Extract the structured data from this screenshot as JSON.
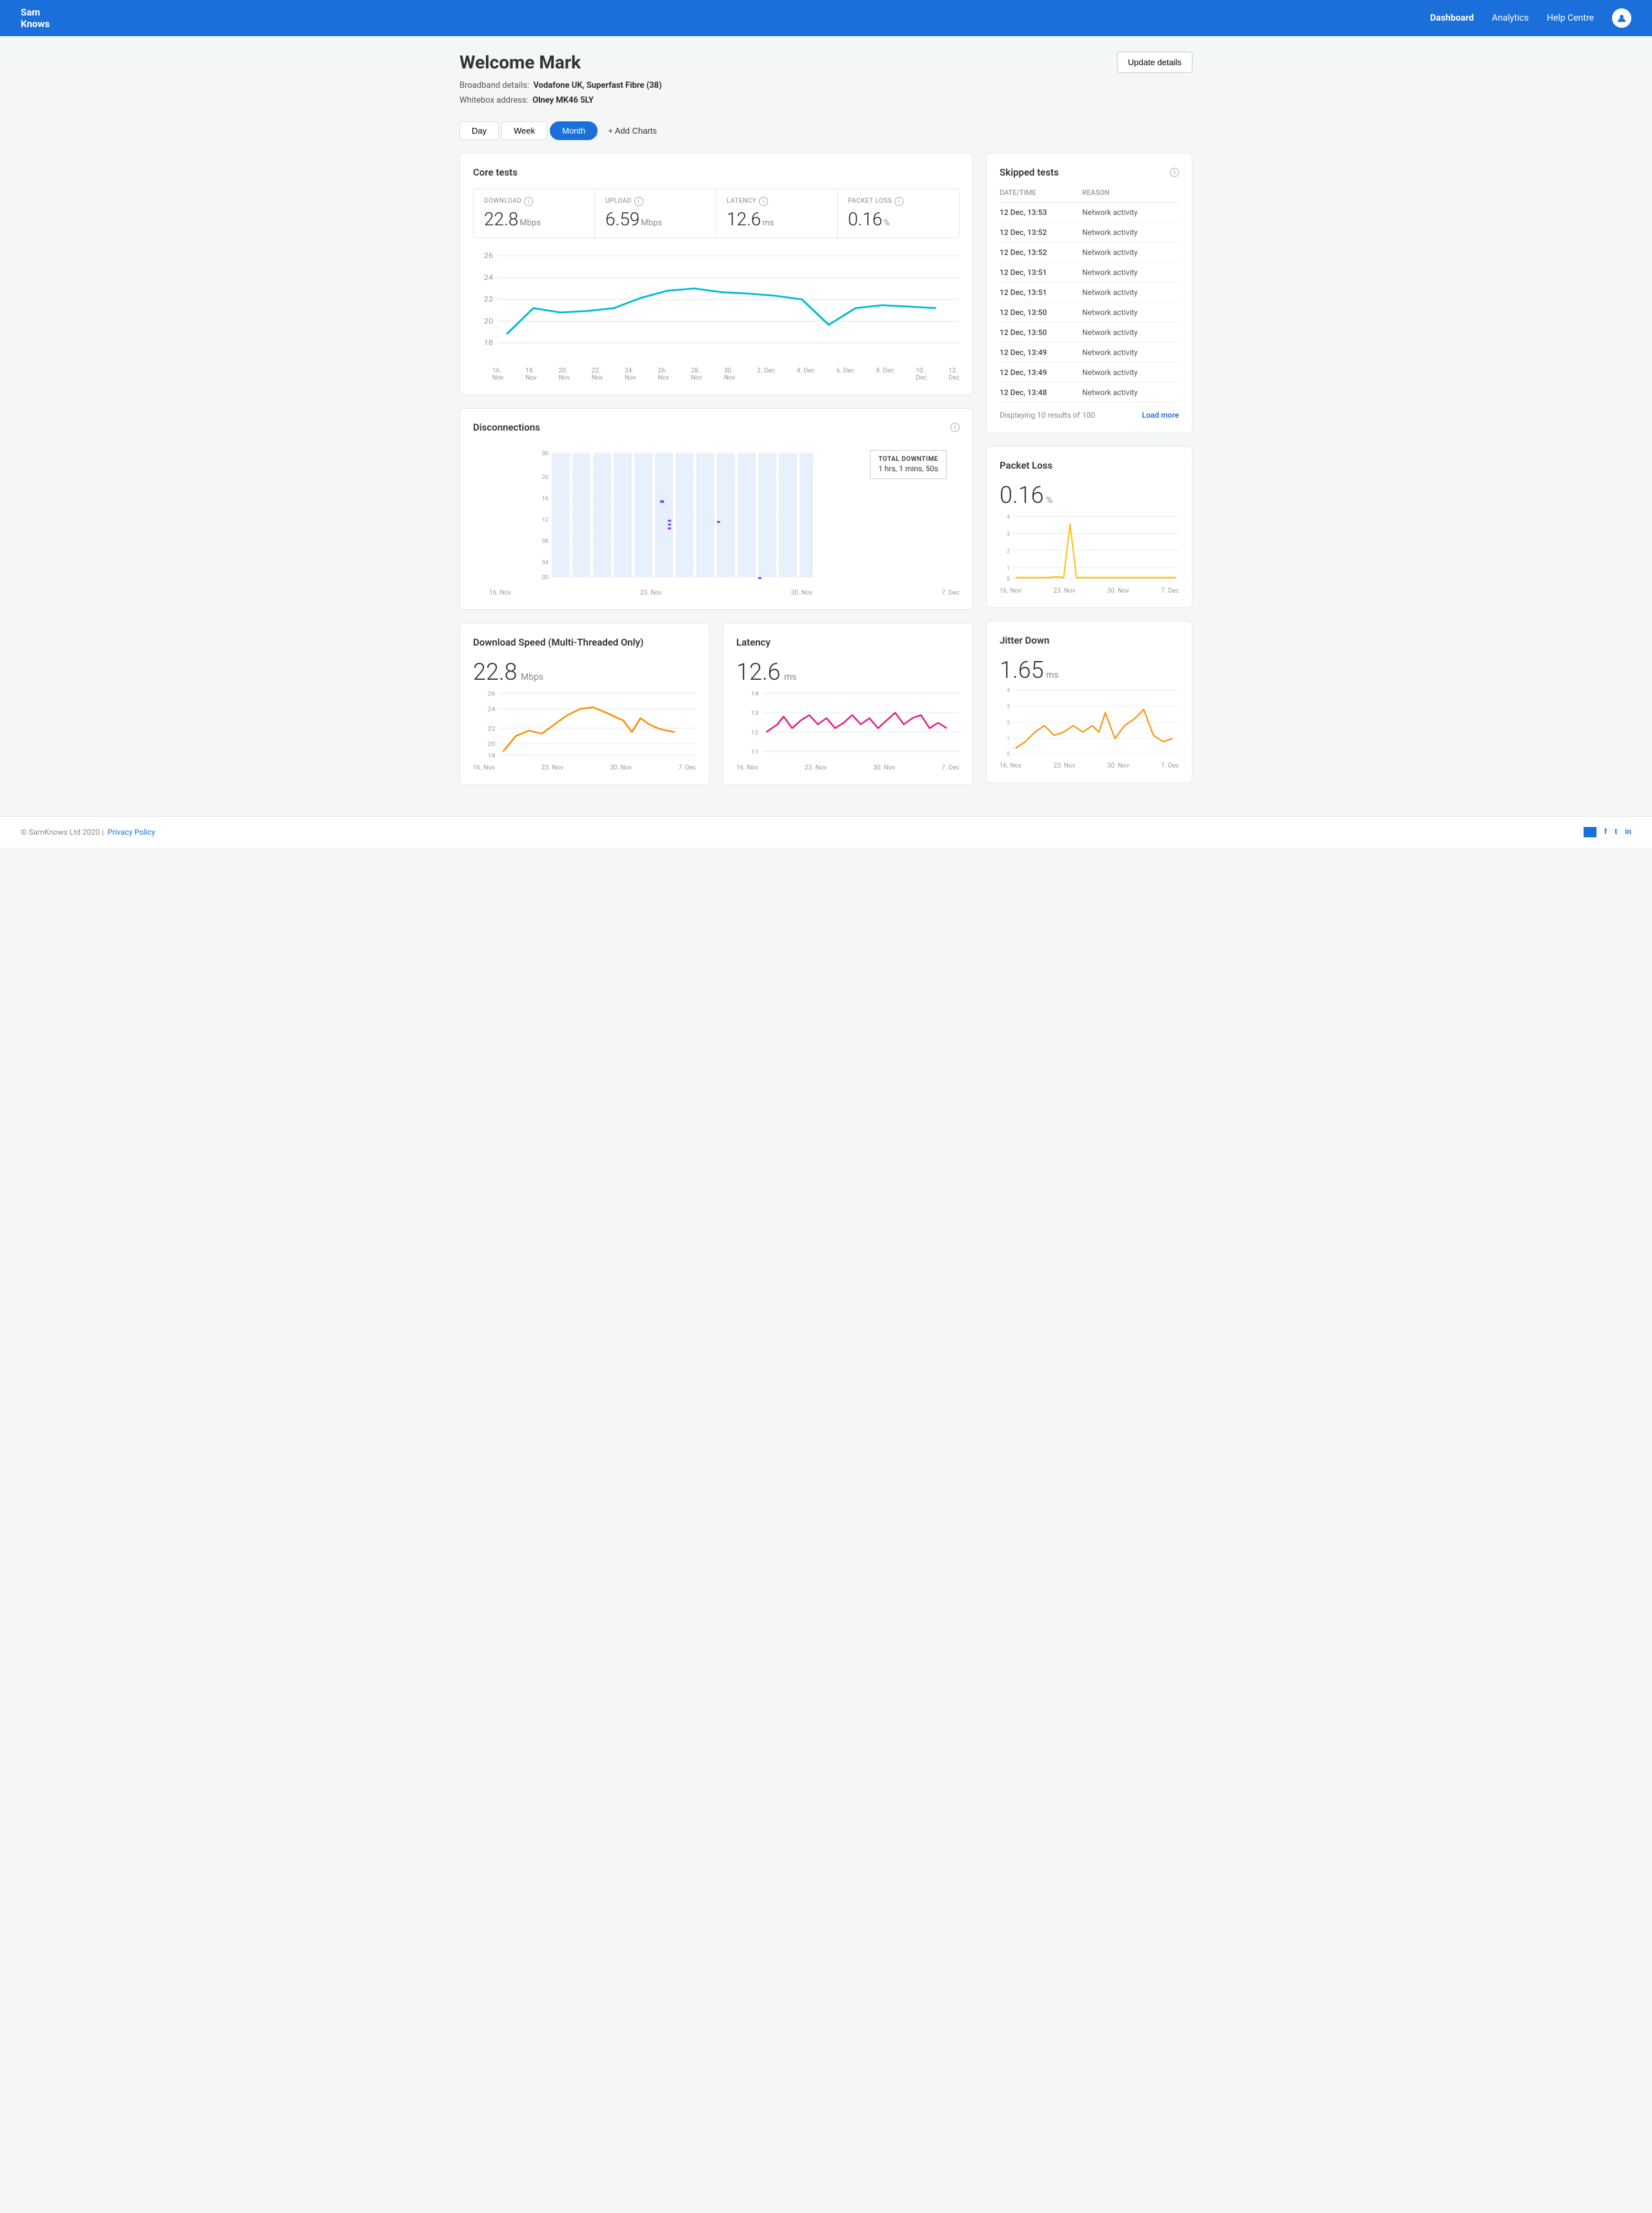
{
  "header": {
    "logo_line1": "Sam",
    "logo_line2": "Knows",
    "nav": [
      {
        "label": "Dashboard",
        "active": true
      },
      {
        "label": "Analytics",
        "active": false
      },
      {
        "label": "Help Centre",
        "active": false
      }
    ]
  },
  "page": {
    "welcome": "Welcome Mark",
    "broadband_label": "Broadband details:",
    "broadband_value": "Vodafone UK, Superfast Fibre (38)",
    "whitebox_label": "Whitebox address:",
    "whitebox_value": "Olney MK46 5LY",
    "update_btn": "Update details"
  },
  "time_tabs": {
    "tabs": [
      "Day",
      "Week",
      "Month"
    ],
    "active": "Month",
    "add_label": "+ Add Charts"
  },
  "core_tests": {
    "title": "Core tests",
    "metrics": [
      {
        "label": "DOWNLOAD",
        "value": "22.8",
        "unit": "Mbps"
      },
      {
        "label": "UPLOAD",
        "value": "6.59",
        "unit": "Mbps"
      },
      {
        "label": "LATENCY",
        "value": "12.6",
        "unit": "ms"
      },
      {
        "label": "PACKET LOSS",
        "value": "0.16",
        "unit": "%"
      }
    ],
    "chart_x_labels": [
      "16.\nNov",
      "18.\nNov",
      "20.\nNov",
      "22.\nNov",
      "24.\nNov",
      "26.\nNov",
      "28.\nNov",
      "30.\nNov",
      "2. Dec",
      "4. Dec",
      "6. Dec",
      "8. Dec",
      "10.\nDec",
      "12.\nDec"
    ]
  },
  "disconnections": {
    "title": "Disconnections",
    "total_downtime_label": "TOTAL DOWNTIME",
    "total_downtime_value": "1 hrs, 1 mins, 50s",
    "chart_x_labels": [
      "16. Nov",
      "23. Nov",
      "30. Nov",
      "7. Dec"
    ],
    "chart_y_labels": [
      "00",
      "04",
      "08",
      "12",
      "16",
      "20",
      "00"
    ]
  },
  "skipped_tests": {
    "title": "Skipped tests",
    "col_datetime": "DATE/TIME",
    "col_reason": "REASON",
    "rows": [
      {
        "datetime": "12 Dec, 13:53",
        "reason": "Network activity"
      },
      {
        "datetime": "12 Dec, 13:52",
        "reason": "Network activity"
      },
      {
        "datetime": "12 Dec, 13:52",
        "reason": "Network activity"
      },
      {
        "datetime": "12 Dec, 13:51",
        "reason": "Network activity"
      },
      {
        "datetime": "12 Dec, 13:51",
        "reason": "Network activity"
      },
      {
        "datetime": "12 Dec, 13:50",
        "reason": "Network activity"
      },
      {
        "datetime": "12 Dec, 13:50",
        "reason": "Network activity"
      },
      {
        "datetime": "12 Dec, 13:49",
        "reason": "Network activity"
      },
      {
        "datetime": "12 Dec, 13:49",
        "reason": "Network activity"
      },
      {
        "datetime": "12 Dec, 13:48",
        "reason": "Network activity"
      }
    ],
    "footer_text": "Displaying 10 results of 100",
    "load_more": "Load more"
  },
  "packet_loss_card": {
    "title": "Packet Loss",
    "value": "0.16",
    "unit": "%",
    "chart_x_labels": [
      "16. Nov",
      "23. Nov",
      "30. Nov",
      "7. Dec"
    ],
    "chart_y_labels": [
      "0",
      "1",
      "2",
      "3",
      "4"
    ]
  },
  "jitter_down_card": {
    "title": "Jitter Down",
    "value": "1.65",
    "unit": "ms",
    "chart_x_labels": [
      "16. Nov",
      "23. Nov",
      "30. Nov",
      "7. Dec"
    ],
    "chart_y_labels": [
      "0",
      "1",
      "2",
      "3",
      "4"
    ]
  },
  "download_speed_card": {
    "title": "Download Speed (Multi-Threaded Only)",
    "value": "22.8",
    "unit": "Mbps",
    "chart_x_labels": [
      "16. Nov",
      "23. Nov",
      "30. Nov",
      "7. Dec"
    ],
    "chart_y_labels": [
      "18",
      "20",
      "22",
      "24",
      "26"
    ]
  },
  "latency_card": {
    "title": "Latency",
    "value": "12.6",
    "unit": "ms",
    "chart_x_labels": [
      "16. Nov",
      "23. Nov",
      "30. Nov",
      "7. Dec"
    ],
    "chart_y_labels": [
      "11",
      "12",
      "13",
      "14"
    ]
  },
  "footer": {
    "copyright": "© SamKnows Ltd 2020  |",
    "privacy": "Privacy Policy",
    "social": [
      "email-icon",
      "facebook-icon",
      "twitter-icon",
      "linkedin-icon"
    ]
  }
}
